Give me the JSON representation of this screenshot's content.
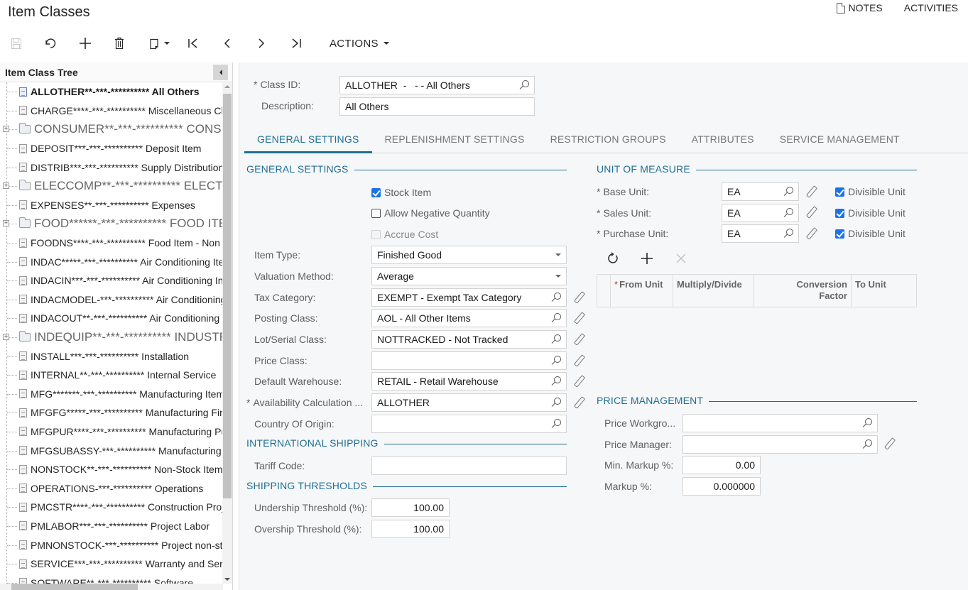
{
  "page": {
    "title": "Item Classes",
    "top_links": {
      "notes": "NOTES",
      "activities": "ACTIVITIES"
    }
  },
  "toolbar": {
    "buttons": [
      {
        "name": "save",
        "icon": "save-icon",
        "enabled": false
      },
      {
        "name": "cancel",
        "icon": "undo-icon",
        "enabled": true
      },
      {
        "name": "add",
        "icon": "plus-icon",
        "enabled": true
      },
      {
        "name": "delete",
        "icon": "trash-icon",
        "enabled": true
      },
      {
        "name": "copy-paste",
        "icon": "clipboard-icon",
        "enabled": true
      },
      {
        "name": "first",
        "icon": "first-record-icon",
        "enabled": true
      },
      {
        "name": "previous",
        "icon": "chevron-left-icon",
        "enabled": true
      },
      {
        "name": "next",
        "icon": "chevron-right-icon",
        "enabled": true
      },
      {
        "name": "last",
        "icon": "last-record-icon",
        "enabled": true
      }
    ],
    "actions_label": "ACTIONS"
  },
  "tree": {
    "title": "Item Class Tree",
    "items": [
      {
        "label": "ALLOTHER**-***-********** All Others",
        "type": "file",
        "selected": true
      },
      {
        "label": "CHARGE****-***-********** Miscellaneous Charges",
        "type": "file"
      },
      {
        "label": "CONSUMER**-***-********** CONSUMER",
        "type": "folder"
      },
      {
        "label": "DEPOSIT***-***-********** Deposit Item",
        "type": "file"
      },
      {
        "label": "DISTRIB***-***-********** Supply Distribution",
        "type": "file"
      },
      {
        "label": "ELECCOMP**-***-********** ELECTRONIC",
        "type": "folder"
      },
      {
        "label": "EXPENSES**-***-********** Expenses",
        "type": "file"
      },
      {
        "label": "FOOD******-***-********** FOOD ITEMS",
        "type": "folder"
      },
      {
        "label": "FOODNS****-***-********** Food Item - Non Stock",
        "type": "file"
      },
      {
        "label": "INDAC*****-***-********** Air Conditioning Items",
        "type": "file"
      },
      {
        "label": "INDACIN***-***-********** Air Conditioning Indoor",
        "type": "file"
      },
      {
        "label": "INDACMODEL-***-********** Air Conditioning Model",
        "type": "file"
      },
      {
        "label": "INDACOUT**-***-********** Air Conditioning Outdoor",
        "type": "file"
      },
      {
        "label": "INDEQUIP**-***-********** INDUSTRIAL",
        "type": "folder"
      },
      {
        "label": "INSTALL***-***-********** Installation",
        "type": "file"
      },
      {
        "label": "INTERNAL**-***-********** Internal Service",
        "type": "file"
      },
      {
        "label": "MFG*******-***-********** Manufacturing Items",
        "type": "file"
      },
      {
        "label": "MFGFG*****-***-********** Manufacturing Finished",
        "type": "file"
      },
      {
        "label": "MFGPUR****-***-********** Manufacturing Purchased",
        "type": "file"
      },
      {
        "label": "MFGSUBASSY-***-********** Manufacturing Subassembly",
        "type": "file"
      },
      {
        "label": "NONSTOCK**-***-********** Non-Stock Items",
        "type": "file"
      },
      {
        "label": "OPERATIONS-***-********** Operations",
        "type": "file"
      },
      {
        "label": "PMCSTR****-***-********** Construction Project",
        "type": "file"
      },
      {
        "label": "PMLABOR***-***-********** Project Labor",
        "type": "file"
      },
      {
        "label": "PMNONSTOCK-***-********** Project non-stock",
        "type": "file"
      },
      {
        "label": "SERVICE***-***-********** Warranty and Service",
        "type": "file"
      },
      {
        "label": "SOFTWARE**-***-********** Software",
        "type": "file"
      }
    ]
  },
  "header_form": {
    "class_id": {
      "label": "Class ID:",
      "required": true,
      "value": "ALLOTHER  -   - - All Others"
    },
    "description": {
      "label": "Description:",
      "value": "All Others"
    }
  },
  "tabs": [
    {
      "label": "GENERAL SETTINGS",
      "active": true
    },
    {
      "label": "REPLENISHMENT SETTINGS"
    },
    {
      "label": "RESTRICTION GROUPS"
    },
    {
      "label": "ATTRIBUTES"
    },
    {
      "label": "SERVICE MANAGEMENT"
    }
  ],
  "general_settings": {
    "title": "GENERAL SETTINGS",
    "stock_item": {
      "label": "Stock Item",
      "checked": true
    },
    "allow_negative_qty": {
      "label": "Allow Negative Quantity",
      "checked": false
    },
    "accrue_cost": {
      "label": "Accrue Cost",
      "checked": false,
      "disabled": true
    },
    "item_type": {
      "label": "Item Type:",
      "value": "Finished Good"
    },
    "valuation_method": {
      "label": "Valuation Method:",
      "value": "Average"
    },
    "tax_category": {
      "label": "Tax Category:",
      "value": "EXEMPT - Exempt Tax Category"
    },
    "posting_class": {
      "label": "Posting Class:",
      "value": "AOL - All Other Items"
    },
    "lot_serial_class": {
      "label": "Lot/Serial Class:",
      "value": "NOTTRACKED - Not Tracked"
    },
    "price_class": {
      "label": "Price Class:",
      "value": ""
    },
    "default_warehouse": {
      "label": "Default Warehouse:",
      "value": "RETAIL - Retail Warehouse"
    },
    "availability_calc": {
      "label": "Availability Calculation ...",
      "required": true,
      "value": "ALLOTHER"
    },
    "country_of_origin": {
      "label": "Country Of Origin:",
      "value": ""
    }
  },
  "international_shipping": {
    "title": "INTERNATIONAL SHIPPING",
    "tariff_code": {
      "label": "Tariff Code:",
      "value": ""
    }
  },
  "shipping_thresholds": {
    "title": "SHIPPING THRESHOLDS",
    "undership": {
      "label": "Undership Threshold (%):",
      "value": "100.00"
    },
    "overship": {
      "label": "Overship Threshold (%):",
      "value": "100.00"
    }
  },
  "unit_of_measure": {
    "title": "UNIT OF MEASURE",
    "base_unit": {
      "label": "Base Unit:",
      "required": true,
      "value": "EA",
      "divisible_label": "Divisible Unit",
      "divisible": true
    },
    "sales_unit": {
      "label": "Sales Unit:",
      "required": true,
      "value": "EA",
      "divisible_label": "Divisible Unit",
      "divisible": true
    },
    "purchase_unit": {
      "label": "Purchase Unit:",
      "required": true,
      "value": "EA",
      "divisible_label": "Divisible Unit",
      "divisible": true
    },
    "grid_tools": [
      {
        "name": "refresh",
        "icon": "refresh-icon",
        "enabled": true
      },
      {
        "name": "add-row",
        "icon": "plus-icon",
        "enabled": true
      },
      {
        "name": "delete-row",
        "icon": "close-icon",
        "enabled": false
      }
    ],
    "grid_columns": [
      {
        "label": "From Unit",
        "required": true
      },
      {
        "label": "Multiply/Divide"
      },
      {
        "label": "Conversion Factor"
      },
      {
        "label": "To Unit"
      }
    ]
  },
  "price_management": {
    "title": "PRICE MANAGEMENT",
    "price_workgroup": {
      "label": "Price Workgro...",
      "value": ""
    },
    "price_manager": {
      "label": "Price Manager:",
      "value": ""
    },
    "min_markup": {
      "label": "Min. Markup %:",
      "value": "0.00"
    },
    "markup": {
      "label": "Markup %:",
      "value": "0.000000"
    }
  },
  "colors": {
    "accent": "#1f6f94",
    "checkbox": "#1a73e8"
  }
}
